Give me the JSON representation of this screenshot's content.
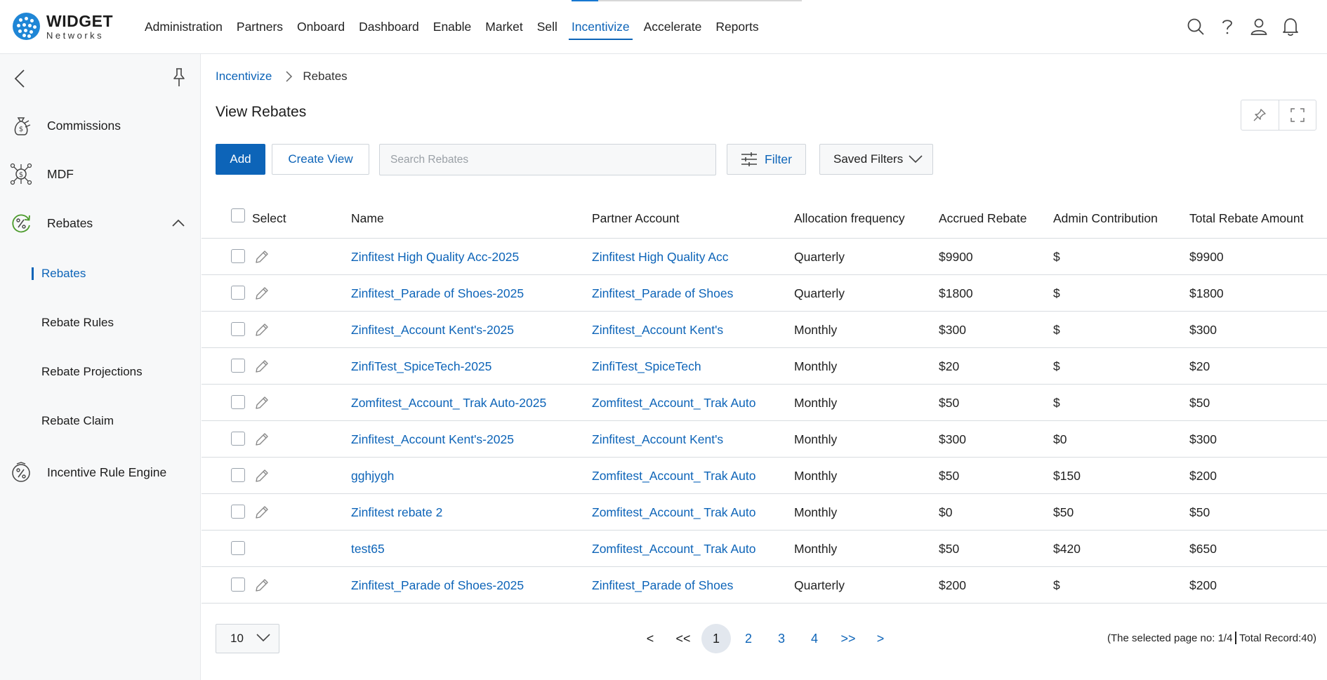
{
  "brand": {
    "name": "WIDGET",
    "sub": "Networks"
  },
  "nav": [
    {
      "label": "Administration",
      "active": false
    },
    {
      "label": "Partners",
      "active": false
    },
    {
      "label": "Onboard",
      "active": false
    },
    {
      "label": "Dashboard",
      "active": false
    },
    {
      "label": "Enable",
      "active": false
    },
    {
      "label": "Market",
      "active": false
    },
    {
      "label": "Sell",
      "active": false
    },
    {
      "label": "Incentivize",
      "active": true
    },
    {
      "label": "Accelerate",
      "active": false
    },
    {
      "label": "Reports",
      "active": false
    }
  ],
  "top_icons": [
    "search-icon",
    "help-icon",
    "user-icon",
    "bell-icon"
  ],
  "sidebar": {
    "items": [
      {
        "label": "Commissions",
        "icon": "money-bag-icon"
      },
      {
        "label": "MDF",
        "icon": "network-dollar-icon"
      },
      {
        "label": "Rebates",
        "icon": "percent-cycle-icon",
        "expanded": true
      },
      {
        "label": "Incentive Rule Engine",
        "icon": "percent-rule-icon"
      }
    ],
    "sub_items": [
      {
        "label": "Rebates",
        "active": true
      },
      {
        "label": "Rebate Rules",
        "active": false
      },
      {
        "label": "Rebate Projections",
        "active": false
      },
      {
        "label": "Rebate Claim",
        "active": false
      }
    ]
  },
  "breadcrumb": {
    "parent": "Incentivize",
    "current": "Rebates"
  },
  "page_title": "View Rebates",
  "toolbar": {
    "add_label": "Add",
    "create_view_label": "Create View",
    "search_placeholder": "Search Rebates",
    "filter_label": "Filter",
    "saved_filters_label": "Saved Filters"
  },
  "table": {
    "columns": [
      "Select",
      "Name",
      "Partner Account",
      "Allocation frequency",
      "Accrued Rebate",
      "Admin Contribution",
      "Total Rebate Amount"
    ],
    "rows": [
      {
        "name": "Zinfitest High Quality Acc-2025",
        "partner": "Zinfitest High Quality Acc",
        "frequency": "Quarterly",
        "accrued": "$9900",
        "admin": "$",
        "total": "$9900",
        "editable": true
      },
      {
        "name": "Zinfitest_Parade of Shoes-2025",
        "partner": "Zinfitest_Parade of Shoes",
        "frequency": "Quarterly",
        "accrued": "$1800",
        "admin": "$",
        "total": "$1800",
        "editable": true
      },
      {
        "name": "Zinfitest_Account Kent's-2025",
        "partner": "Zinfitest_Account Kent's",
        "frequency": "Monthly",
        "accrued": "$300",
        "admin": "$",
        "total": "$300",
        "editable": true
      },
      {
        "name": "ZinfiTest_SpiceTech-2025",
        "partner": "ZinfiTest_SpiceTech",
        "frequency": "Monthly",
        "accrued": "$20",
        "admin": "$",
        "total": "$20",
        "editable": true
      },
      {
        "name": "Zomfitest_Account_ Trak Auto-2025",
        "partner": "Zomfitest_Account_ Trak Auto",
        "frequency": "Monthly",
        "accrued": "$50",
        "admin": "$",
        "total": "$50",
        "editable": true
      },
      {
        "name": "Zinfitest_Account Kent's-2025",
        "partner": "Zinfitest_Account Kent's",
        "frequency": "Monthly",
        "accrued": "$300",
        "admin": "$0",
        "total": "$300",
        "editable": true
      },
      {
        "name": "gghjygh",
        "partner": "Zomfitest_Account_ Trak Auto",
        "frequency": "Monthly",
        "accrued": "$50",
        "admin": "$150",
        "total": "$200",
        "editable": true
      },
      {
        "name": "Zinfitest rebate 2",
        "partner": "Zomfitest_Account_ Trak Auto",
        "frequency": "Monthly",
        "accrued": "$0",
        "admin": "$50",
        "total": "$50",
        "editable": true
      },
      {
        "name": "test65",
        "partner": "Zomfitest_Account_ Trak Auto",
        "frequency": "Monthly",
        "accrued": "$50",
        "admin": "$420",
        "total": "$650",
        "editable": false
      },
      {
        "name": "Zinfitest_Parade of Shoes-2025",
        "partner": "Zinfitest_Parade of Shoes",
        "frequency": "Quarterly",
        "accrued": "$200",
        "admin": "$",
        "total": "$200",
        "editable": true
      }
    ]
  },
  "pagination": {
    "page_size": "10",
    "prev": "<",
    "first": "<<",
    "pages": [
      "1",
      "2",
      "3",
      "4"
    ],
    "current": "1",
    "last": ">>",
    "next": ">",
    "info_page": "(The selected page no: 1/4",
    "info_total": "Total Record:40)"
  },
  "colors": {
    "accent": "#0d64b8",
    "border": "#d8dce0",
    "sidebar_bg": "#f7f8f9"
  }
}
